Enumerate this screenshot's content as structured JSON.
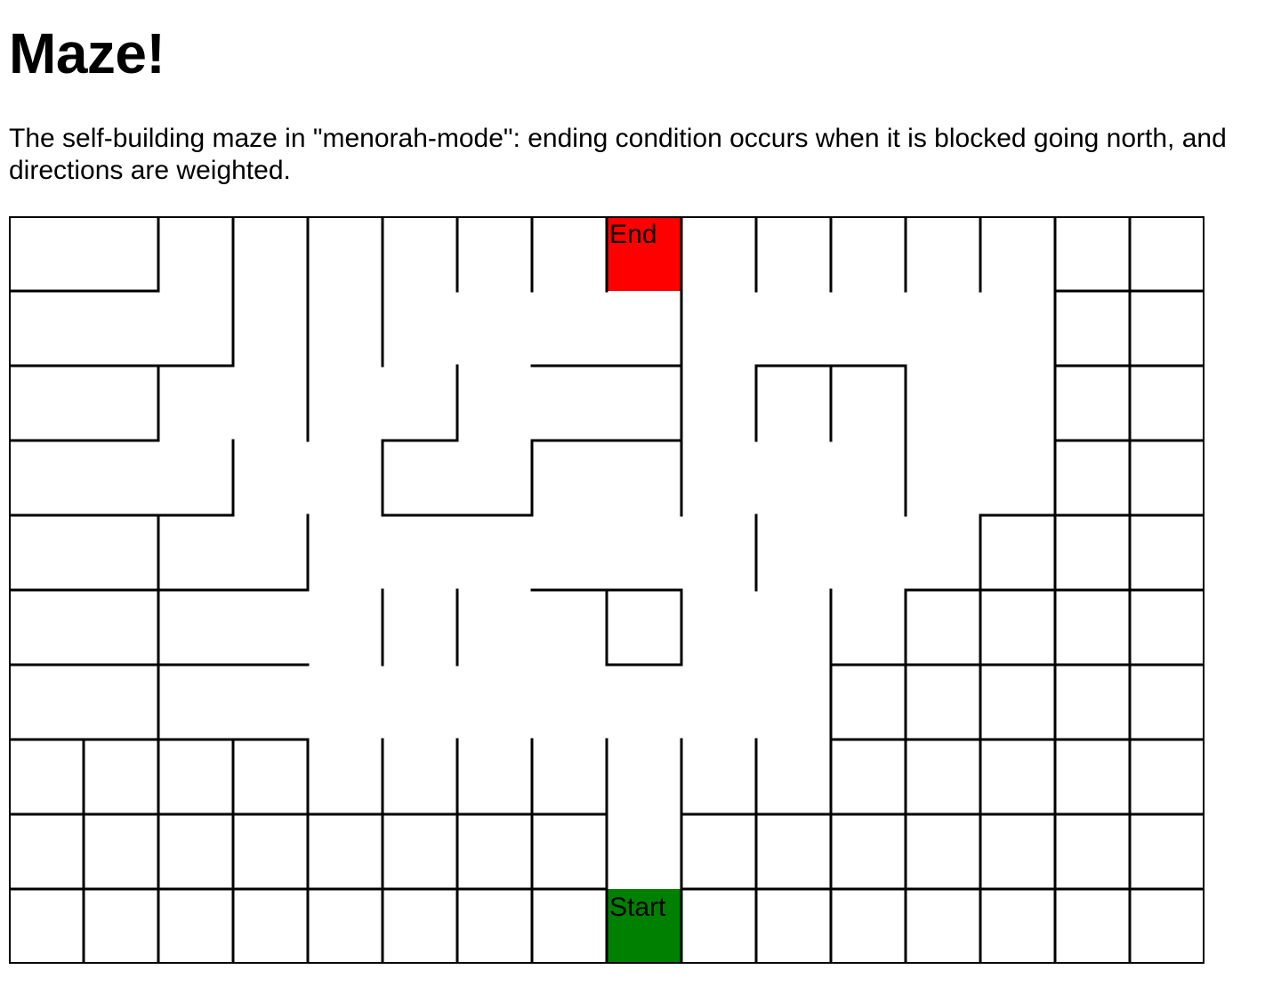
{
  "page": {
    "title": "Maze!",
    "description": "The self-building maze in \"menorah-mode\": ending condition occurs when it is blocked going north, and directions are weighted."
  },
  "maze": {
    "rows": 10,
    "cols": 16,
    "wall_color": "#000000",
    "start": {
      "row": 9,
      "col": 8,
      "label": "Start",
      "color": "#008000"
    },
    "end": {
      "row": 0,
      "col": 8,
      "label": "End",
      "color": "#ff0000"
    },
    "open_h": [
      [],
      [
        2,
        3,
        4,
        5,
        6,
        7,
        8,
        9,
        10,
        11,
        12,
        13
      ],
      [
        3,
        4,
        5,
        6,
        9,
        12,
        13
      ],
      [
        2,
        3,
        4,
        6,
        9,
        10,
        11,
        12,
        13
      ],
      [
        3,
        4,
        7,
        8,
        9,
        10,
        11,
        12
      ],
      [
        4,
        5,
        6,
        9,
        10,
        11
      ],
      [
        4,
        5,
        6,
        7,
        9,
        10
      ],
      [
        4,
        5,
        6,
        7,
        8,
        9,
        10
      ],
      [
        8
      ],
      [
        8
      ]
    ],
    "open_v": [
      [
        1
      ],
      [
        1,
        2,
        6,
        7,
        8,
        10,
        11,
        12,
        13
      ],
      [
        1,
        3,
        5,
        7,
        8,
        13
      ],
      [
        1,
        2,
        4,
        6,
        8,
        10,
        11,
        13
      ],
      [
        1,
        3,
        5,
        6,
        7,
        8,
        9,
        11,
        12
      ],
      [
        1,
        3,
        4,
        7,
        10
      ],
      [
        1,
        3,
        4,
        5,
        6,
        7,
        8,
        9,
        10
      ],
      [],
      [],
      []
    ]
  }
}
